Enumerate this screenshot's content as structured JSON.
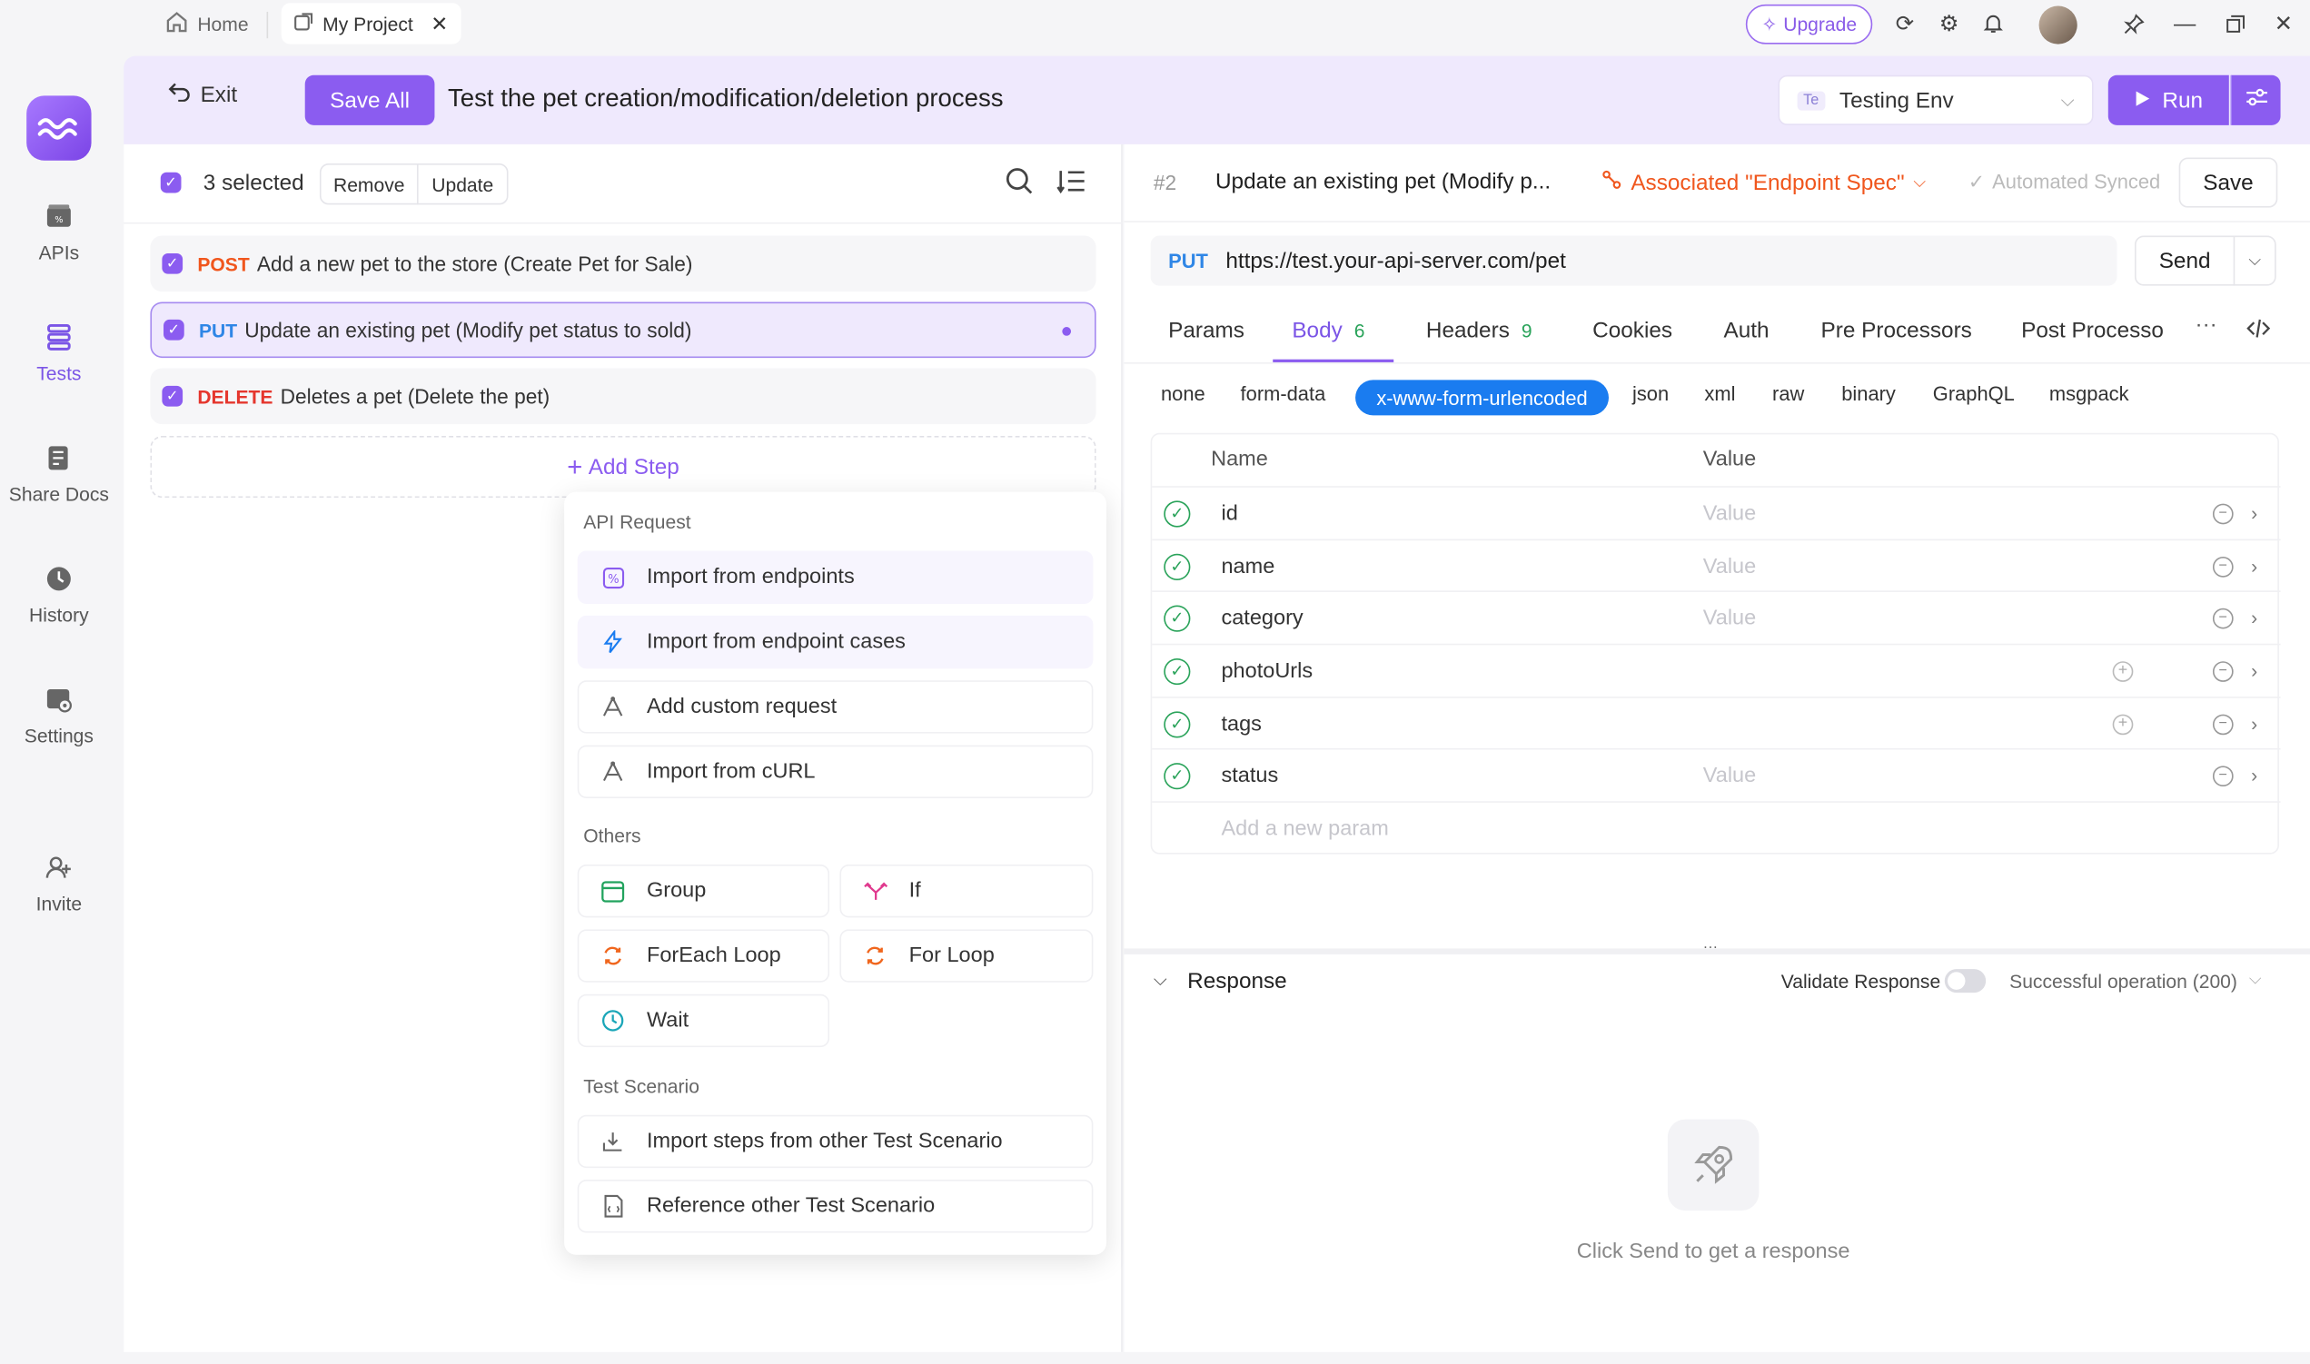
{
  "titlebar": {
    "tabs": [
      {
        "label": "Home",
        "icon": "home-icon"
      },
      {
        "label": "My Project",
        "icon": "external-link-icon"
      }
    ],
    "upgrade_label": "Upgrade"
  },
  "leftnav": {
    "items": [
      {
        "label": "APIs"
      },
      {
        "label": "Tests"
      },
      {
        "label": "Share Docs"
      },
      {
        "label": "History"
      },
      {
        "label": "Settings"
      },
      {
        "label": "Invite"
      }
    ]
  },
  "header": {
    "exit_label": "Exit",
    "saveall_label": "Save All",
    "title": "Test the pet creation/modification/deletion process",
    "env_badge": "Te",
    "env_label": "Testing Env",
    "run_label": "Run"
  },
  "selection": {
    "count_label": "3 selected",
    "remove_label": "Remove",
    "update_label": "Update"
  },
  "steps": [
    {
      "method": "POST",
      "method_color": "#f0561d",
      "text": "Add a new pet to the store (Create Pet for Sale)"
    },
    {
      "method": "PUT",
      "method_color": "#2f86e6",
      "text": "Update an existing pet (Modify pet status to sold)"
    },
    {
      "method": "DELETE",
      "method_color": "#e5362d",
      "text": "Deletes a pet (Delete the pet)"
    }
  ],
  "add_step_label": "Add Step",
  "dropdown": {
    "api_section": "API Request",
    "api_items": [
      "Import from endpoints",
      "Import from endpoint cases",
      "Add custom request",
      "Import from cURL"
    ],
    "others_section": "Others",
    "others_items": [
      "Group",
      "If",
      "ForEach Loop",
      "For Loop",
      "Wait"
    ],
    "scenario_section": "Test Scenario",
    "scenario_items": [
      "Import steps from other Test Scenario",
      "Reference other Test Scenario"
    ]
  },
  "request": {
    "step_number": "2",
    "title": "Update an existing pet (Modify p...",
    "associated_label": "Associated \"Endpoint Spec\"",
    "synced_label": "Automated Synced",
    "save_label": "Save",
    "method": "PUT",
    "url": "https://test.your-api-server.com/pet",
    "send_label": "Send",
    "tabs": [
      {
        "label": "Params",
        "count": ""
      },
      {
        "label": "Body",
        "count": "6"
      },
      {
        "label": "Headers",
        "count": "9"
      },
      {
        "label": "Cookies",
        "count": ""
      },
      {
        "label": "Auth",
        "count": ""
      },
      {
        "label": "Pre Processors",
        "count": ""
      },
      {
        "label": "Post Processo",
        "count": ""
      }
    ],
    "more_label": "···",
    "body_types": [
      "none",
      "form-data",
      "x-www-form-urlencoded",
      "json",
      "xml",
      "raw",
      "binary",
      "GraphQL",
      "msgpack"
    ],
    "active_body_type": "x-www-form-urlencoded",
    "table_headers": {
      "name": "Name",
      "value": "Value"
    },
    "params": [
      {
        "name": "id",
        "value_placeholder": "Value"
      },
      {
        "name": "name",
        "value_placeholder": "Value"
      },
      {
        "name": "category",
        "value_placeholder": "Value"
      },
      {
        "name": "photoUrls",
        "value_placeholder": ""
      },
      {
        "name": "tags",
        "value_placeholder": ""
      },
      {
        "name": "status",
        "value_placeholder": "Value"
      }
    ],
    "add_param_placeholder": "Add a new param"
  },
  "response": {
    "title": "Response",
    "validate_label": "Validate Response",
    "validate_on": false,
    "status_label": "Successful operation (200)",
    "empty_text": "Click Send to get a response"
  },
  "colors": {
    "accent": "#8b5cf0",
    "active_pill": "#1a7cf0",
    "associated": "#f0561d",
    "check_green": "#2aa35a"
  }
}
